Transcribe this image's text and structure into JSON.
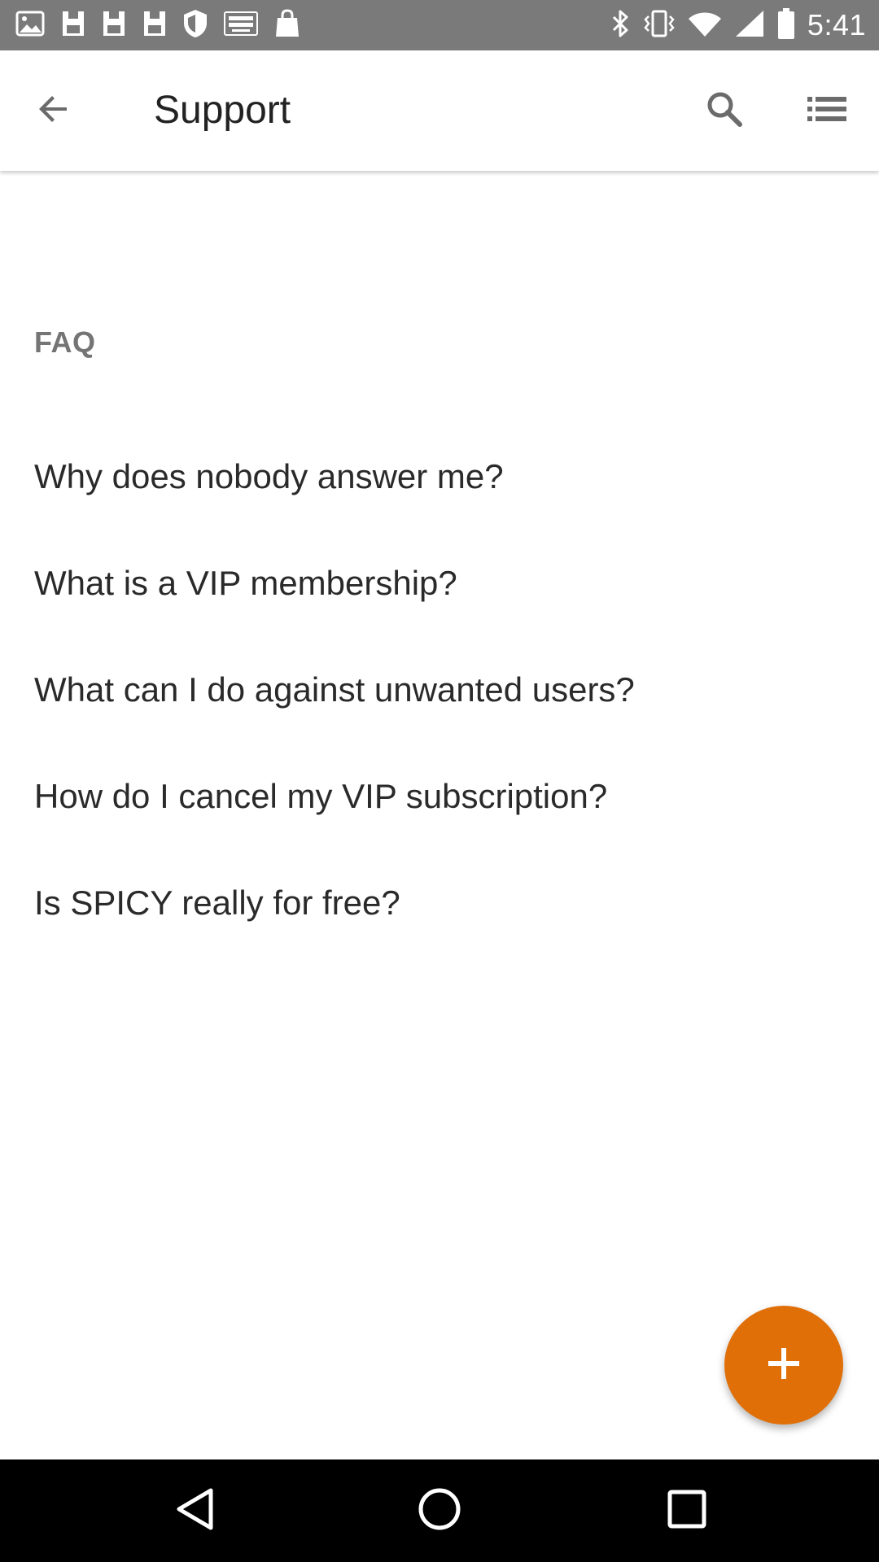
{
  "status_bar": {
    "time": "5:41",
    "left_icons": [
      "photos-icon",
      "save-icon",
      "save-icon",
      "save-icon",
      "shield-icon",
      "espn-dallas-icon",
      "shopping-bag-icon"
    ],
    "right_icons": [
      "bluetooth-icon",
      "vibrate-icon",
      "wifi-icon",
      "signal-icon",
      "battery-icon"
    ]
  },
  "app_bar": {
    "title": "Support",
    "back_icon": "arrow-back-icon",
    "search_icon": "search-icon",
    "menu_icon": "list-menu-icon"
  },
  "faq": {
    "header": "FAQ",
    "items": [
      {
        "label": "Why does nobody answer me?"
      },
      {
        "label": "What is a VIP membership?"
      },
      {
        "label": "What can I do against unwanted users?"
      },
      {
        "label": "How do I cancel my VIP subscription?"
      },
      {
        "label": "Is SPICY really for free?"
      }
    ]
  },
  "fab": {
    "icon": "plus-icon",
    "color": "#e06f08"
  },
  "nav_bar": {
    "back_icon": "nav-back-icon",
    "home_icon": "nav-home-icon",
    "recents_icon": "nav-recents-icon"
  },
  "colors": {
    "status_bar": "#7a7a7a",
    "accent": "#e06f08",
    "text_primary": "#2a2a2a",
    "text_secondary": "#757575"
  }
}
